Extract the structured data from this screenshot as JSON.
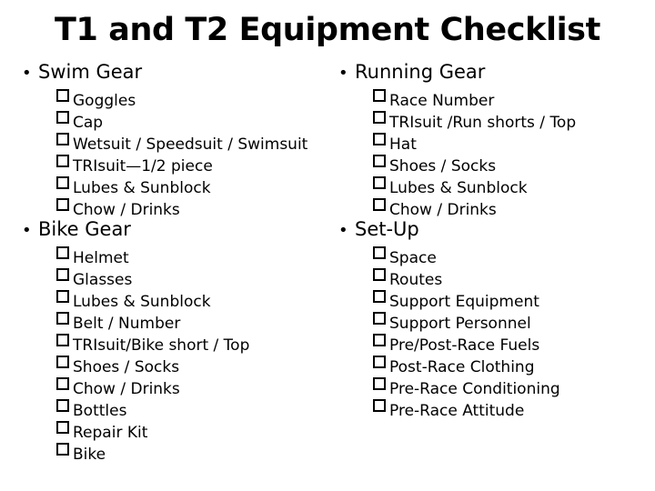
{
  "slide": {
    "title": "T1 and T2 Equipment Checklist",
    "background_color": "#ffffff",
    "text_color": "#000000",
    "bullet_glyph": "•",
    "checkbox_glyph": "❑"
  },
  "columns": {
    "left": {
      "sections": [
        {
          "label": "Swim Gear",
          "items": [
            "Goggles",
            "Cap",
            "Wetsuit / Speedsuit / Swimsuit",
            "TRIsuit—1/2 piece",
            "Lubes & Sunblock",
            "Chow / Drinks"
          ]
        },
        {
          "label": "Bike Gear",
          "items": [
            "Helmet",
            "Glasses",
            "Lubes & Sunblock",
            "Belt / Number",
            "TRIsuit/Bike short / Top",
            "Shoes / Socks",
            "Chow / Drinks",
            "Bottles",
            "Repair Kit",
            "Bike"
          ]
        }
      ]
    },
    "right": {
      "sections": [
        {
          "label": "Running Gear",
          "items": [
            "Race Number",
            "TRIsuit /Run shorts / Top",
            "Hat",
            "Shoes / Socks",
            "Lubes & Sunblock",
            "Chow / Drinks"
          ]
        },
        {
          "label": "Set-Up",
          "items": [
            "Space",
            "Routes",
            "Support Equipment",
            "Support Personnel",
            "Pre/Post-Race Fuels",
            "Post-Race Clothing",
            "Pre-Race Conditioning",
            "Pre-Race Attitude"
          ]
        }
      ]
    }
  }
}
